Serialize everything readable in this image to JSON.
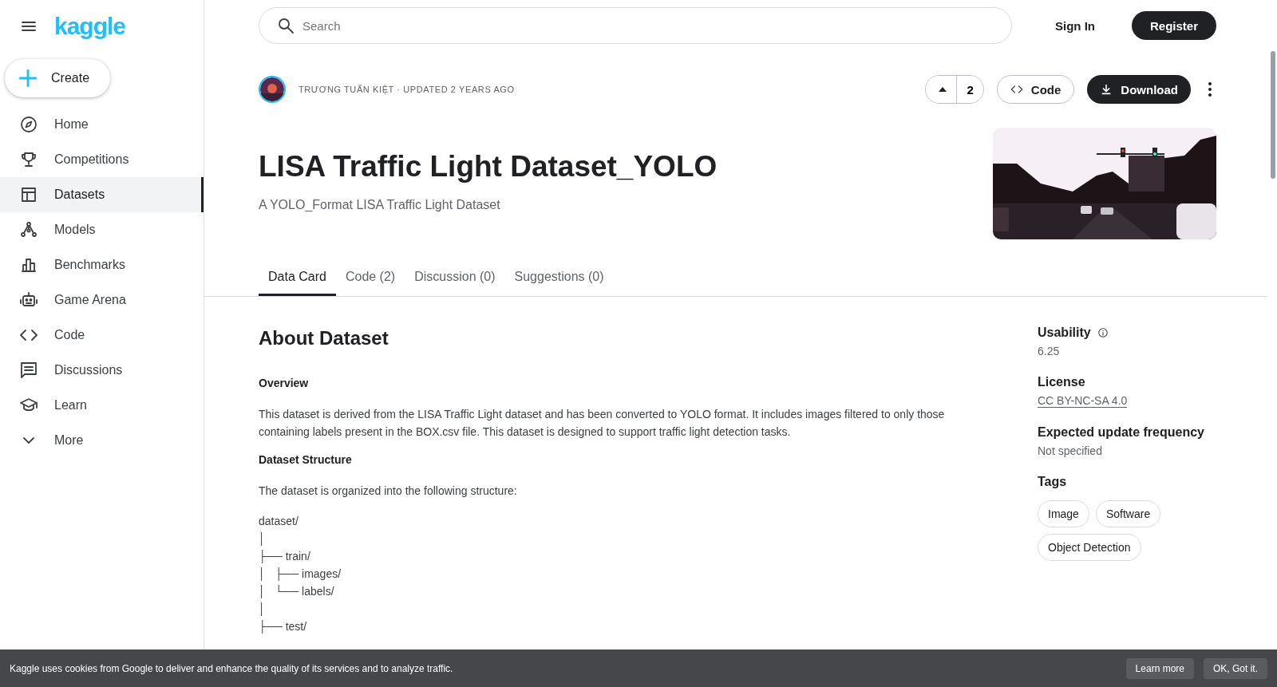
{
  "sidebar": {
    "logo": "kaggle",
    "create": "Create",
    "items": [
      {
        "label": "Home",
        "selected": false
      },
      {
        "label": "Competitions",
        "selected": false
      },
      {
        "label": "Datasets",
        "selected": true
      },
      {
        "label": "Models",
        "selected": false
      },
      {
        "label": "Benchmarks",
        "selected": false
      },
      {
        "label": "Game Arena",
        "selected": false
      },
      {
        "label": "Code",
        "selected": false
      },
      {
        "label": "Discussions",
        "selected": false
      },
      {
        "label": "Learn",
        "selected": false
      },
      {
        "label": "More",
        "selected": false
      }
    ]
  },
  "topbar": {
    "search": {
      "placeholder": "Search"
    },
    "sign_in": "Sign In",
    "register": "Register"
  },
  "header": {
    "meta": "TRƯƠNG TUẤN KIỆT · UPDATED 2 YEARS AGO",
    "upvotes": "2",
    "code_button": "Code",
    "download_button": "Download",
    "title": "LISA Traffic Light Dataset_YOLO",
    "subtitle": "A YOLO_Format LISA Traffic Light Dataset"
  },
  "tabs": [
    {
      "label": "Data Card",
      "selected": true
    },
    {
      "label": "Code (2)",
      "selected": false
    },
    {
      "label": "Discussion (0)",
      "selected": false
    },
    {
      "label": "Suggestions (0)",
      "selected": false
    }
  ],
  "about": {
    "heading": "About Dataset",
    "sections": [
      {
        "kind": "subheading",
        "text": "Overview"
      },
      {
        "kind": "paragraph",
        "text": "This dataset is derived from the LISA Traffic Light dataset and has been converted to YOLO format. It includes images filtered to only those containing labels present in the BOX.csv file. This dataset is designed to support traffic light detection tasks."
      },
      {
        "kind": "subheading",
        "text": "Dataset Structure"
      },
      {
        "kind": "paragraph",
        "text": "The dataset is organized into the following structure:"
      },
      {
        "kind": "tree",
        "lines": [
          "dataset/",
          "│",
          "├── train/",
          "│   ├── images/",
          "│   └── labels/",
          "│",
          "├── test/"
        ]
      }
    ]
  },
  "side_info": {
    "usability_label": "Usability",
    "usability": "6.25",
    "license_label": "License",
    "license": "CC BY-NC-SA 4.0",
    "frequency_label": "Expected update frequency",
    "frequency": "Not specified",
    "tags_label": "Tags",
    "tags": [
      "Image",
      "Software",
      "Object Detection"
    ]
  },
  "cookie_banner": {
    "text": "Kaggle uses cookies from Google to deliver and enhance the quality of its services and to analyze traffic.",
    "learn_more": "Learn more",
    "ok": "OK, Got it."
  }
}
